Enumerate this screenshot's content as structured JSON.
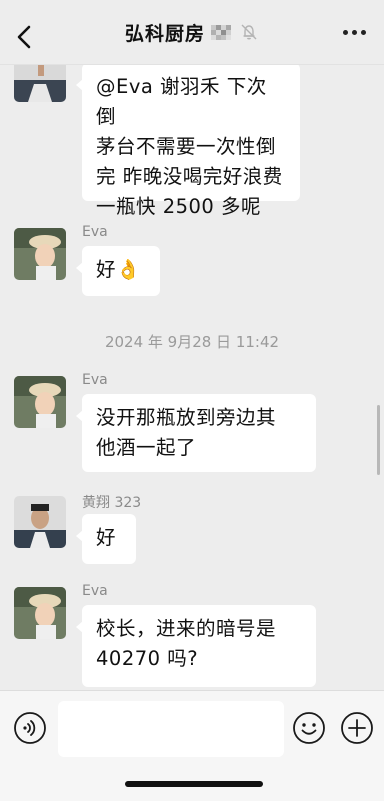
{
  "header": {
    "title": "弘科厨房",
    "back_icon": "chevron-left-icon",
    "mute_icon": "bell-muted-icon",
    "more_icon": "more-dots-icon"
  },
  "messages": [
    {
      "sender": "",
      "text": "@Eva 谢羽禾 下次倒\n茅台不需要一次性倒\n完 昨晚没喝完好浪费\n一瓶快 2500 多呢"
    },
    {
      "sender": "Eva",
      "text": "好👌"
    },
    {
      "sender": "Eva",
      "text": "没开那瓶放到旁边其\n他酒一起了"
    },
    {
      "sender": "黄翔 323",
      "text": "好"
    },
    {
      "sender": "Eva",
      "text": "校长，进来的暗号是\n40270 吗?"
    }
  ],
  "timestamp": "2024 年 9月28 日 11:42",
  "input": {
    "voice_icon": "voice-icon",
    "emoji_icon": "emoji-icon",
    "plus_icon": "plus-icon",
    "placeholder": ""
  },
  "colors": {
    "background": "#ededed",
    "bubble": "#ffffff",
    "meta_text": "#8a8a8a"
  }
}
